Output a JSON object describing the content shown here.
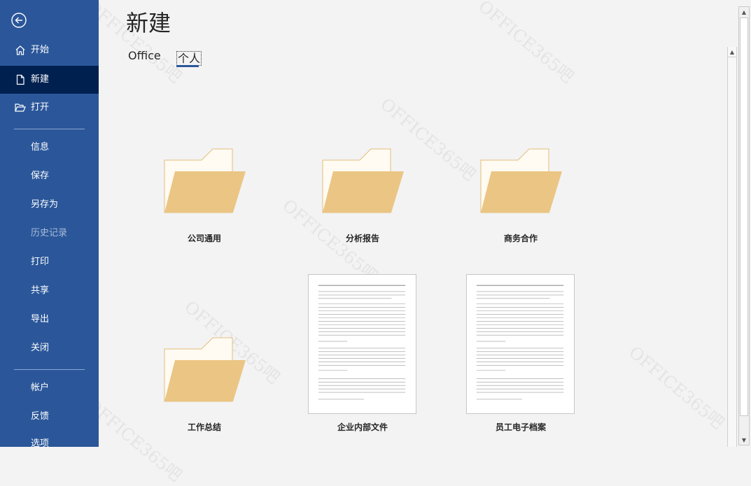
{
  "sidebar": {
    "items": [
      {
        "key": "home",
        "label": "开始",
        "icon": "home-icon"
      },
      {
        "key": "new",
        "label": "新建",
        "icon": "new-document-icon"
      },
      {
        "key": "open",
        "label": "打开",
        "icon": "open-folder-icon"
      },
      {
        "key": "info",
        "label": "信息"
      },
      {
        "key": "save",
        "label": "保存"
      },
      {
        "key": "saveas",
        "label": "另存为"
      },
      {
        "key": "history",
        "label": "历史记录"
      },
      {
        "key": "print",
        "label": "打印"
      },
      {
        "key": "share",
        "label": "共享"
      },
      {
        "key": "export",
        "label": "导出"
      },
      {
        "key": "close",
        "label": "关闭"
      },
      {
        "key": "account",
        "label": "帐户"
      },
      {
        "key": "feedback",
        "label": "反馈"
      },
      {
        "key": "options",
        "label": "选项"
      }
    ],
    "active": "新建",
    "disabled": "历史记录"
  },
  "main": {
    "title": "新建",
    "tabs": [
      {
        "label": "Office"
      },
      {
        "label": "个人",
        "selected": true
      }
    ],
    "items": [
      {
        "label": "公司通用",
        "kind": "folder"
      },
      {
        "label": "分析报告",
        "kind": "folder"
      },
      {
        "label": "商务合作",
        "kind": "folder"
      },
      {
        "label": "工作总结",
        "kind": "folder"
      },
      {
        "label": "企业内部文件",
        "kind": "document"
      },
      {
        "label": "员工电子档案",
        "kind": "document"
      }
    ]
  },
  "watermark": "OFFICE365吧",
  "colors": {
    "sidebar": "#2b579a",
    "sidebar_active": "#002050",
    "folder_front": "#ebc584",
    "folder_back": "#fffbf2",
    "folder_stroke": "#e2bd7c"
  }
}
